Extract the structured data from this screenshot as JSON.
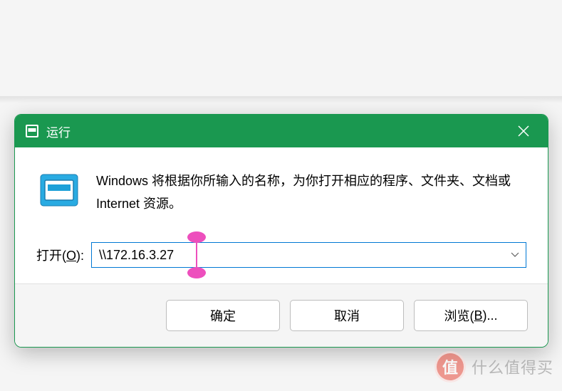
{
  "dialog": {
    "title": "运行",
    "description": "Windows 将根据你所输入的名称，为你打开相应的程序、文件夹、文档或 Internet 资源。",
    "open_label_prefix": "打开(",
    "open_label_key": "O",
    "open_label_suffix": "):",
    "input_value": "\\\\172.16.3.27",
    "buttons": {
      "ok": "确定",
      "cancel": "取消",
      "browse_prefix": "浏览(",
      "browse_key": "B",
      "browse_suffix": ")..."
    }
  },
  "watermark": {
    "badge": "值",
    "text": "什么值得买"
  }
}
